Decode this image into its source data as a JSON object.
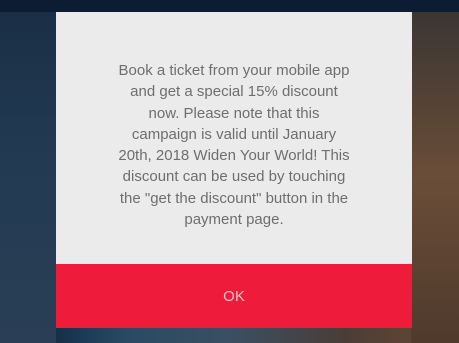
{
  "dialog": {
    "message": "Book a ticket from your mobile app\nand get a special 15% discount\nnow. Please note that this\ncampaign is valid until January\n20th, 2018 Widen Your World! This\ndiscount can be used by touching\nthe \"get the discount\" button in the\npayment page.",
    "ok_label": "OK"
  },
  "colors": {
    "dialog_background": "#ebebeb",
    "button_background": "#ee1c3a",
    "button_text": "#f7c2ca",
    "message_text": "#6e6e6e"
  }
}
